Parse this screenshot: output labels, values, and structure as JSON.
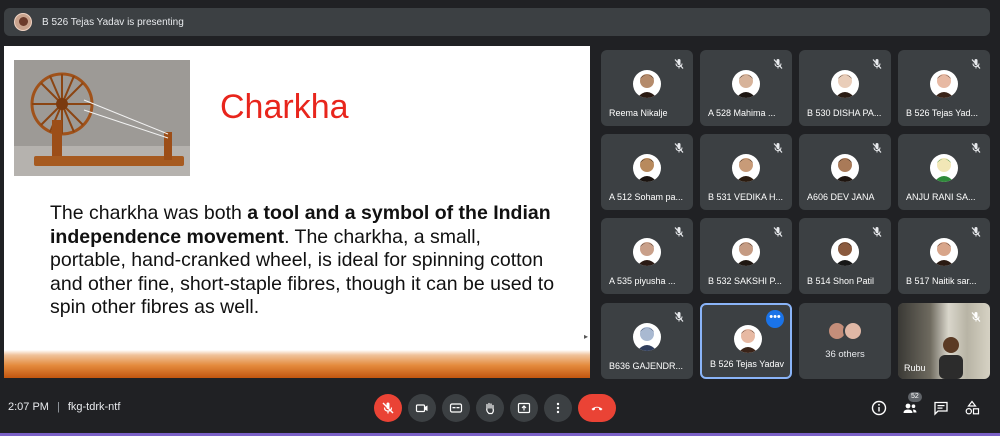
{
  "topbar": {
    "presenting_text": "B 526 Tejas Yadav is presenting"
  },
  "slide": {
    "title": "Charkha",
    "body_pre": "The charkha was both ",
    "body_bold": "a tool and a symbol of the Indian independence movement",
    "body_post": ". The charkha, a small, portable, hand-cranked wheel, is ideal for spinning cotton and other fine, short-staple fibres, though it can be used to spin other fibres as well."
  },
  "participants": [
    {
      "name": "Reema Nikalje",
      "face": "#b58b6b",
      "hair": "#2a1a12"
    },
    {
      "name": "A 528 Mahima ...",
      "face": "#d7b39a",
      "hair": "#1d1612"
    },
    {
      "name": "B 530 DISHA PA...",
      "face": "#e9cdb9",
      "hair": "#2a1c14"
    },
    {
      "name": "B 526 Tejas Yad...",
      "face": "#e7b9a3",
      "hair": "#3a2318"
    },
    {
      "name": "A 512 Soham pa...",
      "face": "#b88a5d",
      "hair": "#1b1410"
    },
    {
      "name": "B 531 VEDIKA H...",
      "face": "#c89b78",
      "hair": "#2c1c10"
    },
    {
      "name": "A606 DEV JANA",
      "face": "#a97a58",
      "hair": "#1e1510"
    },
    {
      "name": "ANJU RANI SA...",
      "face": "#f2e7b6",
      "hair": "#2f8a3a"
    },
    {
      "name": "A 535 piyusha ...",
      "face": "#c9a08a",
      "hair": "#2a1a14"
    },
    {
      "name": "B 532 SAKSHI P...",
      "face": "#c59b83",
      "hair": "#1f1712"
    },
    {
      "name": "B 514 Shon Patil",
      "face": "#8a5a3e",
      "hair": "#171717"
    },
    {
      "name": "B 517 Naitik sar...",
      "face": "#d8a58a",
      "hair": "#2a1a12"
    },
    {
      "name": "B636 GAJENDR...",
      "face": "#a9b9d1",
      "hair": "#2f3d5c"
    },
    {
      "name": "B 526 Tejas Yadav",
      "face": "#e7b9a3",
      "hair": "#3a2318"
    }
  ],
  "others": {
    "label": "36 others"
  },
  "video_tile": {
    "name": "Rubu"
  },
  "bottom": {
    "time": "2:07 PM",
    "separator": "|",
    "meeting_code": "fkg-tdrk-ntf",
    "people_count": "52"
  },
  "colors": {
    "accent": "#8ab4f8",
    "danger": "#ea4335",
    "tile_bg": "#3c4043",
    "page_bg": "#202124"
  }
}
